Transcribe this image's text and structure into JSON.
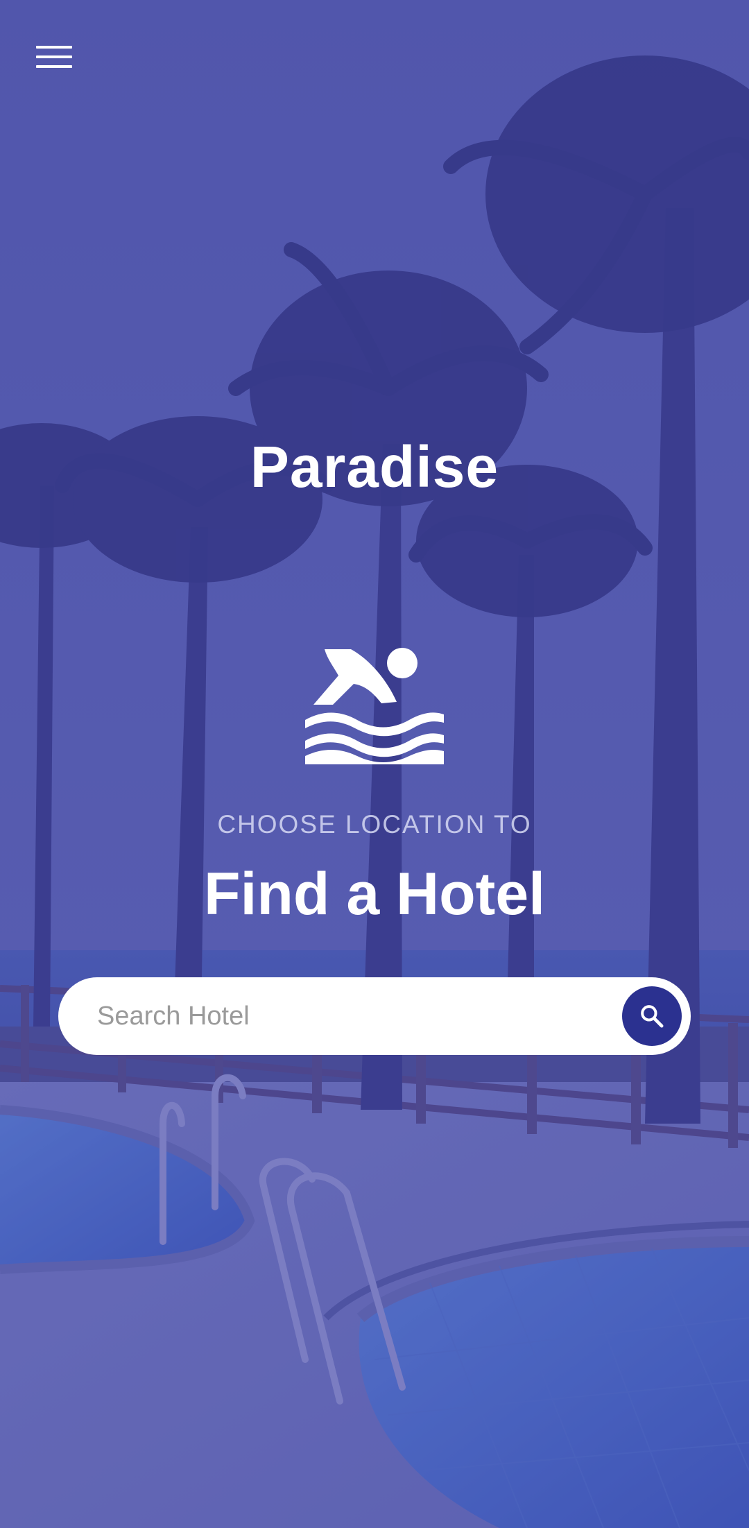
{
  "header": {
    "menu_icon": "hamburger-menu-icon"
  },
  "hero": {
    "app_title": "Paradise",
    "icon": "swimming-pool-icon",
    "subtitle": "CHOOSE LOCATION TO",
    "headline": "Find a Hotel"
  },
  "search": {
    "placeholder": "Search Hotel",
    "value": "",
    "button_icon": "search-icon"
  },
  "colors": {
    "overlay": "#5a5fae",
    "search_button": "#2b3190",
    "text": "#ffffff",
    "subtitle": "#dcdef5",
    "placeholder": "#9a9a9a"
  }
}
